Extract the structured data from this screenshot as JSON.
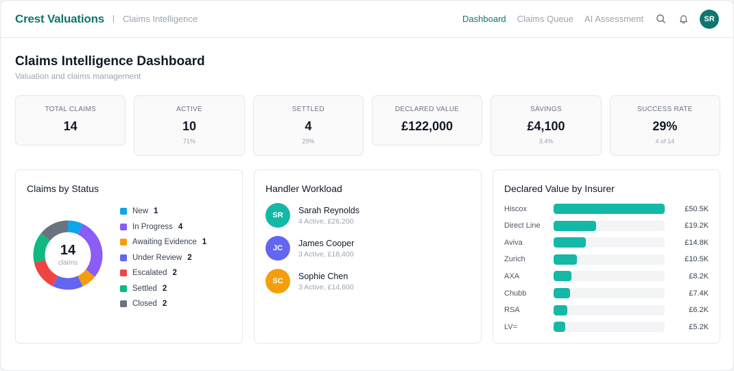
{
  "header": {
    "brand": "Crest Valuations",
    "subtitle": "Claims Intelligence",
    "nav": [
      {
        "label": "Dashboard",
        "active": true
      },
      {
        "label": "Claims Queue",
        "active": false
      },
      {
        "label": "AI Assessment",
        "active": false
      }
    ],
    "user_initials": "SR"
  },
  "page": {
    "title": "Claims Intelligence Dashboard",
    "subtitle": "Valuation and claims management"
  },
  "kpis": [
    {
      "label": "TOTAL CLAIMS",
      "value": "14",
      "sub": ""
    },
    {
      "label": "ACTIVE",
      "value": "10",
      "sub": "71%"
    },
    {
      "label": "SETTLED",
      "value": "4",
      "sub": "29%"
    },
    {
      "label": "DECLARED VALUE",
      "value": "£122,000",
      "sub": ""
    },
    {
      "label": "SAVINGS",
      "value": "£4,100",
      "sub": "3.4%"
    },
    {
      "label": "SUCCESS RATE",
      "value": "29%",
      "sub": "4 of 14"
    }
  ],
  "status_card": {
    "title": "Claims by Status",
    "total": "14",
    "total_label": "claims",
    "items": [
      {
        "label": "New",
        "count": 1,
        "color": "#0ea5e9"
      },
      {
        "label": "In Progress",
        "count": 4,
        "color": "#8b5cf6"
      },
      {
        "label": "Awaiting Evidence",
        "count": 1,
        "color": "#f59e0b"
      },
      {
        "label": "Under Review",
        "count": 2,
        "color": "#6366f1"
      },
      {
        "label": "Escalated",
        "count": 2,
        "color": "#ef4444"
      },
      {
        "label": "Settled",
        "count": 2,
        "color": "#10b981"
      },
      {
        "label": "Closed",
        "count": 2,
        "color": "#6b7280"
      }
    ]
  },
  "workload_card": {
    "title": "Handler Workload",
    "handlers": [
      {
        "initials": "SR",
        "name": "Sarah Reynolds",
        "meta": "4 Active, £26,200",
        "color": "#14b8a6"
      },
      {
        "initials": "JC",
        "name": "James Cooper",
        "meta": "3 Active, £18,400",
        "color": "#6366f1"
      },
      {
        "initials": "SC",
        "name": "Sophie Chen",
        "meta": "3 Active, £14,600",
        "color": "#f59e0b"
      }
    ]
  },
  "insurer_card": {
    "title": "Declared Value by Insurer",
    "bars": [
      {
        "name": "Hiscox",
        "label": "£50.5K",
        "value": 50.5
      },
      {
        "name": "Direct Line",
        "label": "£19.2K",
        "value": 19.2
      },
      {
        "name": "Aviva",
        "label": "£14.8K",
        "value": 14.8
      },
      {
        "name": "Zurich",
        "label": "£10.5K",
        "value": 10.5
      },
      {
        "name": "AXA",
        "label": "£8.2K",
        "value": 8.2
      },
      {
        "name": "Chubb",
        "label": "£7.4K",
        "value": 7.4
      },
      {
        "name": "RSA",
        "label": "£6.2K",
        "value": 6.2
      },
      {
        "name": "LV=",
        "label": "£5.2K",
        "value": 5.2
      }
    ],
    "max": 50.5
  },
  "icons": {
    "search": "search-icon",
    "bell": "bell-icon"
  },
  "colors": {
    "brand": "#0f766e",
    "bar": "#14b8a6"
  }
}
